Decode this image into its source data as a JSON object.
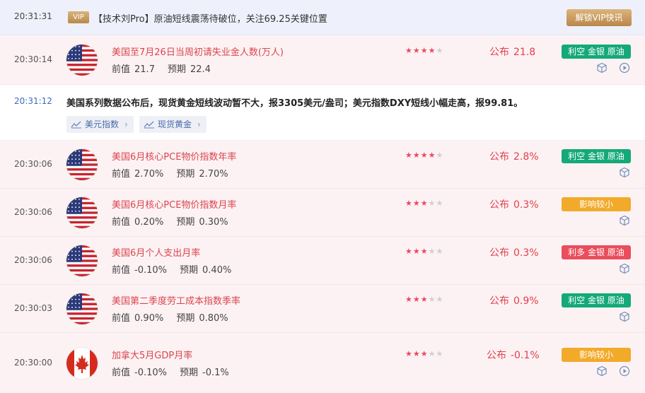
{
  "vip": {
    "time": "20:31:31",
    "badge": "VIP",
    "text": "【技术刘Pro】原油短线震荡待破位，关注69.25关键位置",
    "button": "解锁VIP快讯"
  },
  "news": {
    "time": "20:31:12",
    "text": "美国系列数据公布后，现货黄金短线波动暂不大，报3305美元/盎司；美元指数DXY短线小幅走高，报99.81。",
    "chips": [
      {
        "label": "美元指数",
        "icon": "trend-icon"
      },
      {
        "label": "现货黄金",
        "icon": "trend-icon"
      }
    ]
  },
  "rows": [
    {
      "time": "20:30:14",
      "flag": "us-flag",
      "title": "美国至7月26日当周初请失业金人数(万人)",
      "prev_label": "前值",
      "prev": "21.7",
      "exp_label": "预期",
      "exp": "22.4",
      "stars": 4,
      "actual_label": "公布",
      "actual": "21.8",
      "tag": "利空 金银 原油",
      "tag_color": "#14a979",
      "icons": [
        "cube-icon",
        "play-icon"
      ]
    },
    {
      "time": "20:30:06",
      "flag": "us-flag",
      "title": "美国6月核心PCE物价指数年率",
      "prev_label": "前值",
      "prev": "2.70%",
      "exp_label": "预期",
      "exp": "2.70%",
      "stars": 4,
      "actual_label": "公布",
      "actual": "2.8%",
      "tag": "利空 金银 原油",
      "tag_color": "#14a979",
      "icons": [
        "cube-icon"
      ]
    },
    {
      "time": "20:30:06",
      "flag": "us-flag",
      "title": "美国6月核心PCE物价指数月率",
      "prev_label": "前值",
      "prev": "0.20%",
      "exp_label": "预期",
      "exp": "0.30%",
      "stars": 3,
      "actual_label": "公布",
      "actual": "0.3%",
      "tag": "影响较小",
      "tag_color": "#f2aa2a",
      "icons": [
        "cube-icon"
      ]
    },
    {
      "time": "20:30:06",
      "flag": "us-flag",
      "title": "美国6月个人支出月率",
      "prev_label": "前值",
      "prev": "-0.10%",
      "exp_label": "预期",
      "exp": "0.40%",
      "stars": 3,
      "actual_label": "公布",
      "actual": "0.3%",
      "tag": "利多 金银 原油",
      "tag_color": "#ea4d5c",
      "icons": [
        "cube-icon"
      ]
    },
    {
      "time": "20:30:03",
      "flag": "us-flag",
      "title": "美国第二季度劳工成本指数季率",
      "prev_label": "前值",
      "prev": "0.90%",
      "exp_label": "预期",
      "exp": "0.80%",
      "stars": 3,
      "actual_label": "公布",
      "actual": "0.9%",
      "tag": "利空 金银 原油",
      "tag_color": "#14a979",
      "icons": [
        "cube-icon"
      ]
    },
    {
      "time": "20:30:00",
      "flag": "canada-flag",
      "title": "加拿大5月GDP月率",
      "prev_label": "前值",
      "prev": "-0.10%",
      "exp_label": "预期",
      "exp": "-0.1%",
      "stars": 3,
      "actual_label": "公布",
      "actual": "-0.1%",
      "tag": "影响较小",
      "tag_color": "#f2aa2a",
      "icons": [
        "cube-icon",
        "play-icon"
      ]
    }
  ]
}
